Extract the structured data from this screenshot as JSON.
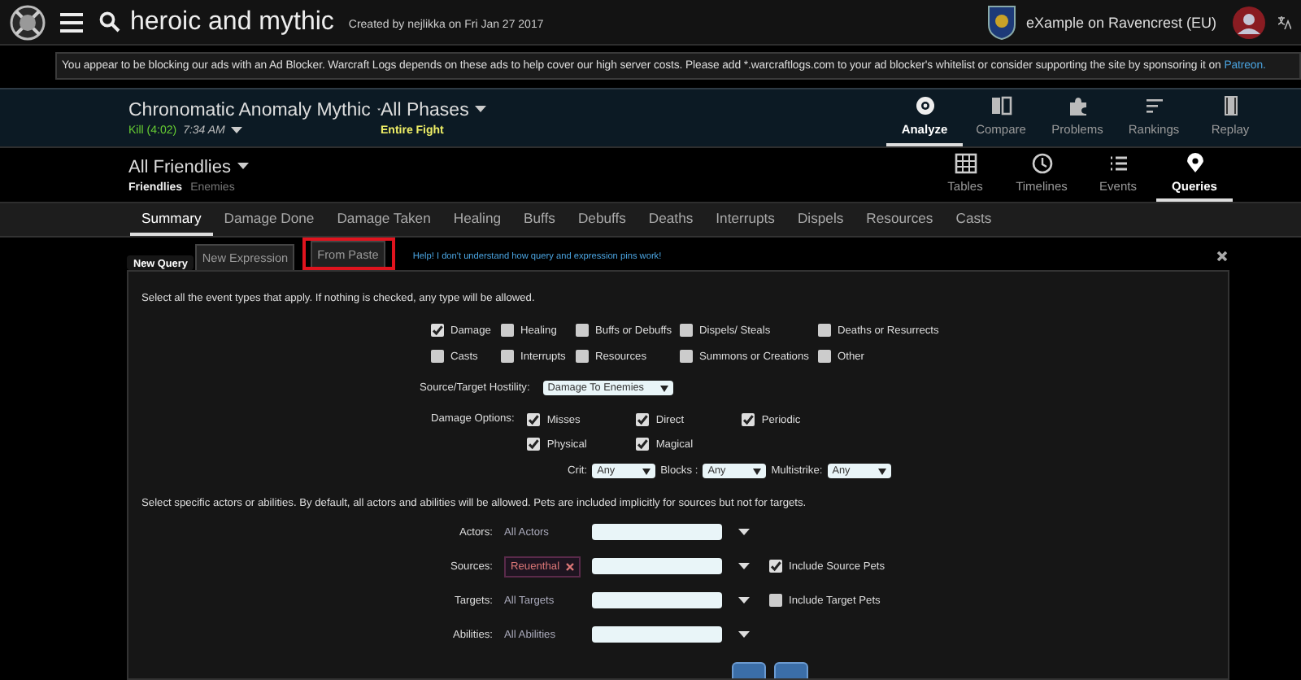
{
  "top_bar": {
    "search_text": "heroic and mythic",
    "created_by": "Created by nejlikka on Fri Jan 27 2017",
    "user": "eXample on Ravencrest (EU)"
  },
  "notice": {
    "text": "You appear to be blocking our ads with an Ad Blocker. Warcraft Logs depends on these ads to help cover our high server costs. Please add *.warcraftlogs.com to your ad blocker's whitelist or consider supporting the site by sponsoring it on ",
    "link": "Patreon."
  },
  "fight": {
    "name": "Chronomatic Anomaly Mythic",
    "result": "Kill (4:02)",
    "time": "7:34 AM",
    "phase": "All Phases",
    "phase_detail": "Entire Fight"
  },
  "main_nav": [
    {
      "label": "Analyze",
      "selected": true
    },
    {
      "label": "Compare",
      "selected": false
    },
    {
      "label": "Problems",
      "selected": false
    },
    {
      "label": "Rankings",
      "selected": false
    },
    {
      "label": "Replay",
      "selected": false
    }
  ],
  "actor_filter": {
    "label": "All Friendlies",
    "options": [
      {
        "label": "Friendlies",
        "selected": true
      },
      {
        "label": "Enemies",
        "selected": false
      }
    ]
  },
  "view_nav": [
    {
      "label": "Tables",
      "selected": false
    },
    {
      "label": "Timelines",
      "selected": false
    },
    {
      "label": "Events",
      "selected": false
    },
    {
      "label": "Queries",
      "selected": true
    }
  ],
  "tabs": [
    {
      "label": "Summary",
      "selected": true
    },
    {
      "label": "Damage Done",
      "selected": false
    },
    {
      "label": "Damage Taken",
      "selected": false
    },
    {
      "label": "Healing",
      "selected": false
    },
    {
      "label": "Buffs",
      "selected": false
    },
    {
      "label": "Debuffs",
      "selected": false
    },
    {
      "label": "Deaths",
      "selected": false
    },
    {
      "label": "Interrupts",
      "selected": false
    },
    {
      "label": "Dispels",
      "selected": false
    },
    {
      "label": "Resources",
      "selected": false
    },
    {
      "label": "Casts",
      "selected": false
    }
  ],
  "query_tabs": [
    {
      "label": "New Query",
      "selected": true,
      "highlighted": false
    },
    {
      "label": "New Expression",
      "selected": false,
      "highlighted": false
    },
    {
      "label": "From Paste",
      "selected": false,
      "highlighted": true
    }
  ],
  "help_link": "Help! I don't understand how query and expression pins work!",
  "query": {
    "intro": "Select all the event types that apply. If nothing is checked, any type will be allowed.",
    "event_types": [
      {
        "label": "Damage",
        "checked": true
      },
      {
        "label": "Healing",
        "checked": false
      },
      {
        "label": "Buffs or Debuffs",
        "checked": false
      },
      {
        "label": "Dispels/ Steals",
        "checked": false
      },
      {
        "label": "Deaths or Resurrects",
        "checked": false
      },
      {
        "label": "Casts",
        "checked": false
      },
      {
        "label": "Interrupts",
        "checked": false
      },
      {
        "label": "Resources",
        "checked": false
      },
      {
        "label": "Summons or Creations",
        "checked": false
      },
      {
        "label": "Other",
        "checked": false
      }
    ],
    "hostility": {
      "label": "Source/Target Hostility:",
      "value": "Damage To Enemies"
    },
    "damage_options": {
      "label": "Damage Options:",
      "options": [
        {
          "label": "Misses",
          "checked": true
        },
        {
          "label": "Direct",
          "checked": true
        },
        {
          "label": "Periodic",
          "checked": true
        },
        {
          "label": "Physical",
          "checked": true
        },
        {
          "label": "Magical",
          "checked": true
        }
      ]
    },
    "filters": [
      {
        "label": "Crit:",
        "value": "Any"
      },
      {
        "label": "Blocks :",
        "value": "Any"
      },
      {
        "label": "Multistrike:",
        "value": "Any"
      }
    ],
    "actors_intro": "Select specific actors or abilities. By default, all actors and abilities will be allowed. Pets are included implicitly for sources but not for targets.",
    "actor_rows": [
      {
        "label": "Actors:",
        "kind": "text",
        "value": "All Actors"
      },
      {
        "label": "Sources:",
        "kind": "tag",
        "value": "Reuenthal",
        "pets": {
          "label": "Include Source Pets",
          "checked": true
        }
      },
      {
        "label": "Targets:",
        "kind": "text",
        "value": "All Targets",
        "pets": {
          "label": "Include Target Pets",
          "checked": false
        }
      },
      {
        "label": "Abilities:",
        "kind": "text",
        "value": "All Abilities"
      }
    ]
  }
}
